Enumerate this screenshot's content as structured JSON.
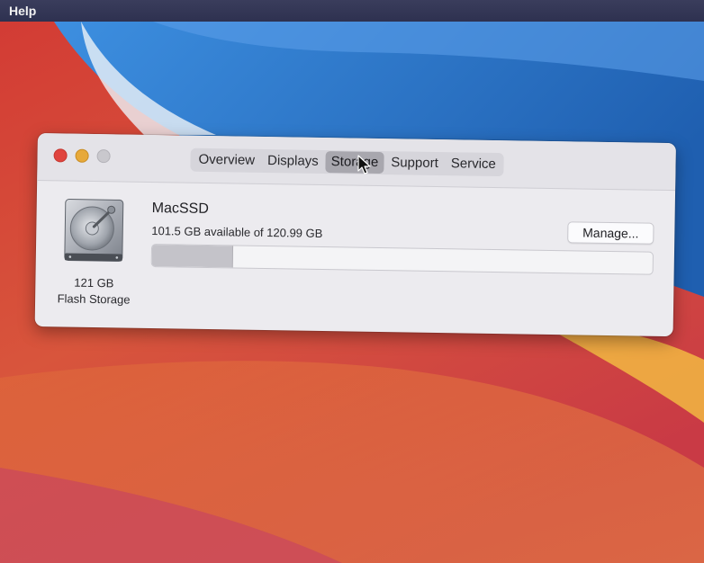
{
  "menubar": {
    "help_label": "Help"
  },
  "window": {
    "tabs": [
      {
        "label": "Overview",
        "active": false
      },
      {
        "label": "Displays",
        "active": false
      },
      {
        "label": "Storage",
        "active": true
      },
      {
        "label": "Support",
        "active": false
      },
      {
        "label": "Service",
        "active": false
      }
    ]
  },
  "storage": {
    "disk_capacity": "121 GB",
    "disk_type": "Flash Storage",
    "volume_name": "MacSSD",
    "availability": "101.5 GB available of 120.99 GB",
    "used_fraction": 0.16,
    "manage_label": "Manage..."
  },
  "colors": {
    "close": "#e0443e",
    "minimize": "#e7a93a",
    "zoom": "#c9c8cd",
    "wallpaper_blue": "#2f7fd0",
    "wallpaper_red": "#d0463a",
    "wallpaper_orange": "#e8763e"
  },
  "icons": {
    "disk": "hard-drive-icon",
    "cursor": "pointer-cursor-icon"
  }
}
